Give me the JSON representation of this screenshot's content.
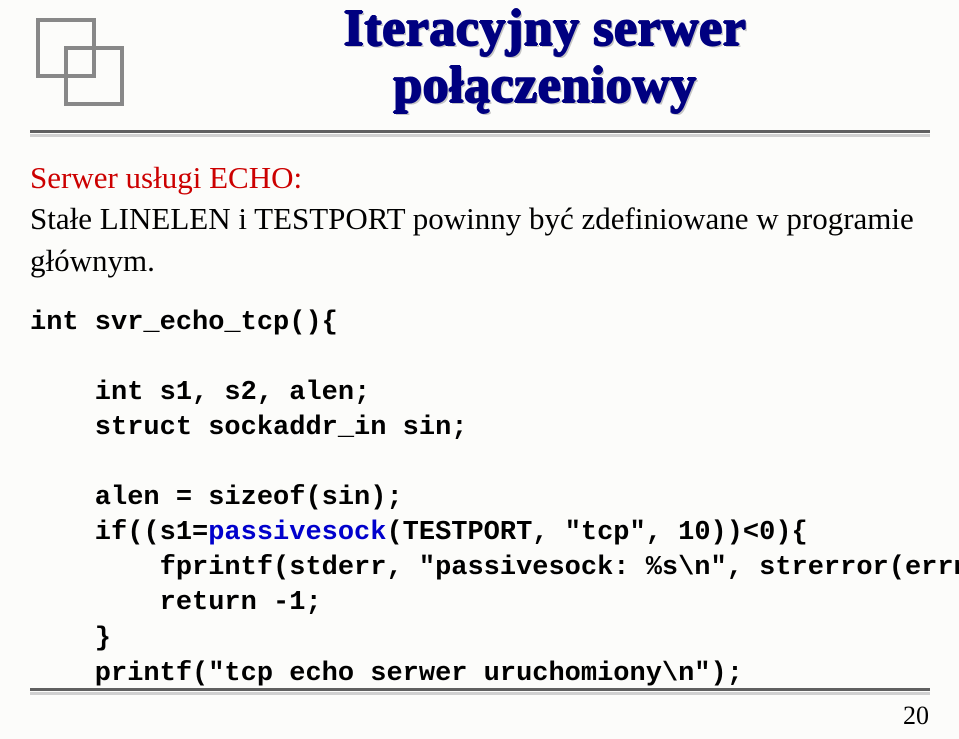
{
  "title": {
    "line1": "Iteracyjny serwer",
    "line2": "połączeniowy"
  },
  "desc": {
    "label": "Serwer usługi ECHO:",
    "body": "Stałe LINELEN i TESTPORT powinny być zdefiniowane w programie głównym."
  },
  "code": {
    "l1": "int svr_echo_tcp(){",
    "l2": "    int s1, s2, alen;",
    "l3": "    struct sockaddr_in sin;",
    "l4": "    alen = sizeof(sin);",
    "l5a": "    if((s1=",
    "l5fn": "passivesock",
    "l5b": "(TESTPORT, \"tcp\", 10))<0){",
    "l6": "        fprintf(stderr, \"passivesock: %s\\n\", strerror(errno));",
    "l7": "        return -1;",
    "l8": "    }",
    "l9": "    printf(\"tcp echo serwer uruchomiony\\n\");"
  },
  "page": "20"
}
